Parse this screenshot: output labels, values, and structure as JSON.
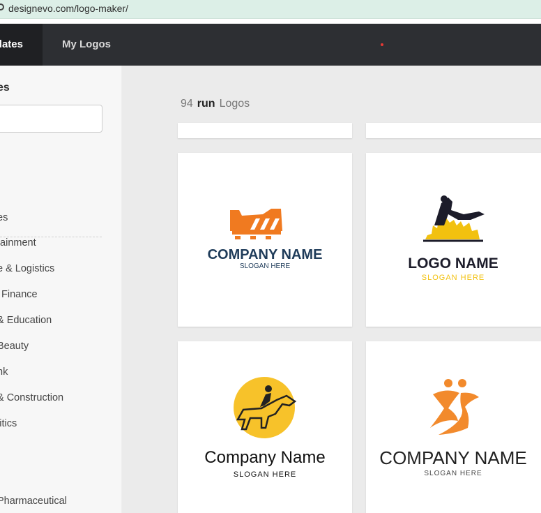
{
  "browser": {
    "url": "designevo.com/logo-maker/"
  },
  "nav": {
    "tabs": [
      {
        "label": "lates"
      },
      {
        "label": "My Logos"
      }
    ]
  },
  "sidebar": {
    "heading": "es",
    "search_placeholder": "",
    "categories": [
      {
        "label": "es"
      },
      {
        "label": "tainment"
      },
      {
        "label": "e & Logistics"
      },
      {
        "label": "Finance"
      },
      {
        "label": "& Education"
      },
      {
        "label": "Beauty"
      },
      {
        "label": "nk"
      },
      {
        "label": "& Construction"
      },
      {
        "label": "litics"
      },
      {
        "label": "Pharmaceutical"
      }
    ]
  },
  "results": {
    "count": "94",
    "query": "run",
    "suffix": "Logos"
  },
  "logos": [
    {
      "name": "COMPANY NAME",
      "slogan": "SLOGAN HERE",
      "icon": "running-shoe-icon",
      "name_color": "#1f3c5a",
      "icon_color": "#f07a20"
    },
    {
      "name": "LOGO NAME",
      "slogan": "SLOGAN HERE",
      "icon": "gymnast-city-icon",
      "name_color": "#1c1c2a",
      "slogan_color": "#f2c10f"
    },
    {
      "name": "Company Name",
      "slogan": "SLOGAN HERE",
      "icon": "horse-jockey-icon",
      "name_color": "#111111",
      "icon_color": "#f7c22a"
    },
    {
      "name": "COMPANY NAME",
      "slogan": "SLOGAN HERE",
      "icon": "runners-icon",
      "name_color": "#222222",
      "icon_color": "#f28a2c"
    }
  ]
}
